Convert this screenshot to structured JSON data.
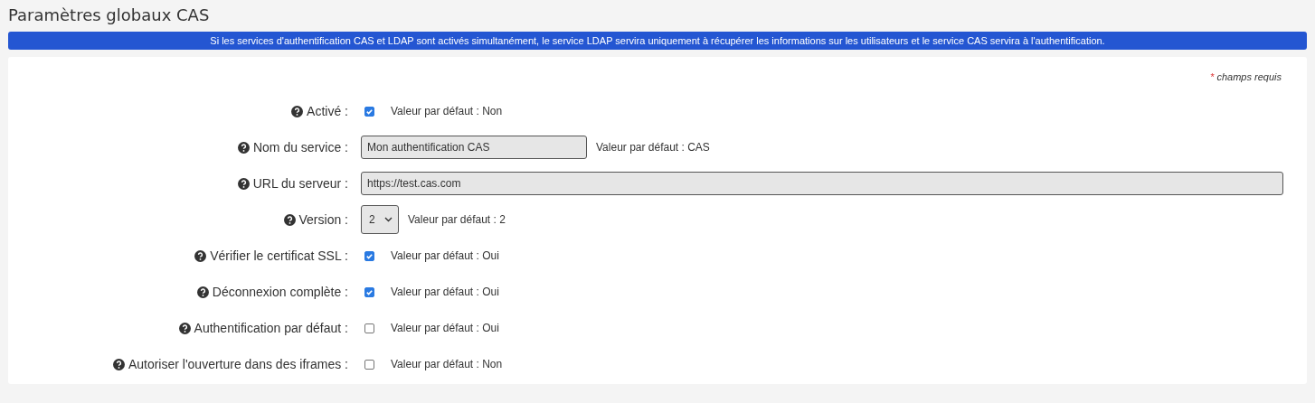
{
  "title": "Paramètres globaux CAS",
  "notice": "Si les services d'authentification CAS et LDAP sont activés simultanément, le service LDAP servira uniquement à récupérer les informations sur les utilisateurs et le service CAS servira à l'authentification.",
  "required_note": {
    "mark": "*",
    "text": "champs requis"
  },
  "fields": [
    {
      "kind": "checkbox",
      "label": "Activé :",
      "checked": true,
      "default": "Valeur par défaut : Non"
    },
    {
      "kind": "text",
      "label": "Nom du service :",
      "value": "Mon authentification CAS",
      "default": "Valeur par défaut : CAS"
    },
    {
      "kind": "text",
      "label": "URL du serveur :",
      "value": "https://test.cas.com"
    },
    {
      "kind": "select",
      "label": "Version :",
      "value": "2",
      "default": "Valeur par défaut : 2"
    },
    {
      "kind": "checkbox",
      "label": "Vérifier le certificat SSL :",
      "checked": true,
      "default": "Valeur par défaut : Oui"
    },
    {
      "kind": "checkbox",
      "label": "Déconnexion complète :",
      "checked": true,
      "default": "Valeur par défaut : Oui"
    },
    {
      "kind": "checkbox",
      "label": "Authentification par défaut :",
      "checked": false,
      "default": "Valeur par défaut : Oui"
    },
    {
      "kind": "checkbox",
      "label": "Autoriser l'ouverture dans des iframes :",
      "checked": false,
      "default": "Valeur par défaut : Non"
    }
  ]
}
